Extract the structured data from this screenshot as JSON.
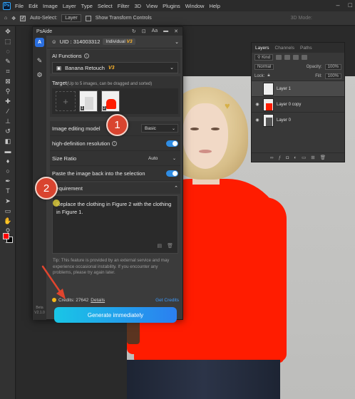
{
  "menubar": {
    "logo": "Ps",
    "items": [
      "File",
      "Edit",
      "Image",
      "Layer",
      "Type",
      "Select",
      "Filter",
      "3D",
      "View",
      "Plugins",
      "Window",
      "Help"
    ]
  },
  "options": {
    "auto_select_label": "Auto-Select:",
    "auto_select_value": "Layer",
    "show_transform_label": "Show Transform Controls",
    "mode_3d": "3D Mode:"
  },
  "layers_panel": {
    "tabs": [
      "Layers",
      "Channels",
      "Paths"
    ],
    "kind_label": "Kind",
    "blend_mode": "Normal",
    "opacity_label": "Opacity:",
    "opacity_value": "100%",
    "lock_label": "Lock:",
    "fill_label": "Fill:",
    "fill_value": "100%",
    "layers": [
      {
        "name": "Layer 1"
      },
      {
        "name": "Layer 0 copy"
      },
      {
        "name": "Layer 0"
      }
    ]
  },
  "psaide": {
    "title": "PsAide",
    "uid": "UID : 314003312",
    "plan": "Individual",
    "plan_version": "V3",
    "ai_functions_label": "AI Functions",
    "function_value": "Banana Retouch",
    "function_version": "V3",
    "target_label": "Target",
    "target_hint": "(Up to 5 images, can be dragged and sorted)",
    "target_nums": [
      "1",
      "2"
    ],
    "image_model_label": "Image editing model",
    "image_model_value": "Basic",
    "hd_label": "high-definition resolution",
    "size_ratio_label": "Size Ratio",
    "size_ratio_value": "Auto",
    "paste_back_label": "Paste the image back into the selection",
    "requirement_label": "Requirement",
    "requirement_text": "Replace the clothing in Figure 2 with the clothing in Figure 1.",
    "tip": "Tip: This feature is provided by an external service and may experience occasional instability. If you encounter any problems, please try again later.",
    "credits_label": "Credits: 27642",
    "details_label": "Details",
    "get_credits_label": "Get Credits",
    "generate_label": "Generate immediately",
    "rail_version": "Beta V2.1.0"
  },
  "annotations": {
    "step1": "1",
    "step2": "2"
  },
  "colors": {
    "accent_blue": "#2f8de4",
    "generate_gradient_start": "#19c6e6",
    "generate_gradient_end": "#2b7ff0",
    "v3_badge": "#ffb62e",
    "step_marker": "#d9442f",
    "foreground_swatch": "#ff0000"
  }
}
